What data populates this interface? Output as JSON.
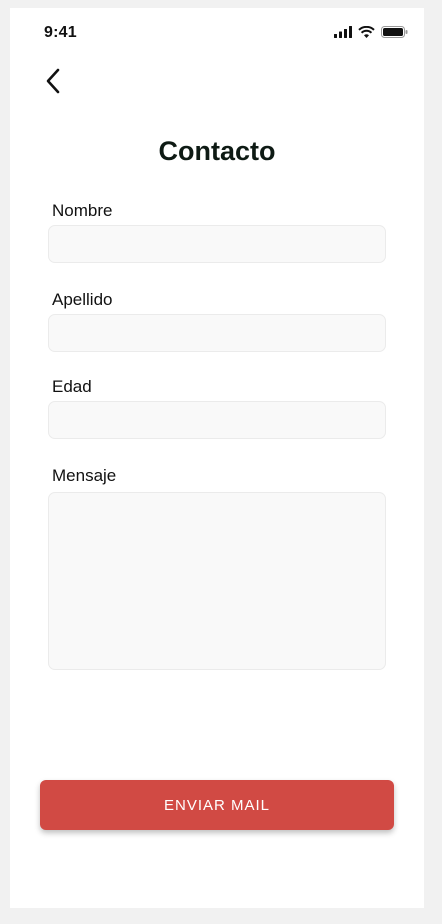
{
  "status_bar": {
    "time": "9:41",
    "icons": [
      "signal-icon",
      "wifi-icon",
      "battery-icon"
    ]
  },
  "header": {
    "back_icon": "chevron-left-icon",
    "title": "Contacto"
  },
  "form": {
    "nombre": {
      "label": "Nombre",
      "value": "",
      "placeholder": ""
    },
    "apellido": {
      "label": "Apellido",
      "value": "",
      "placeholder": ""
    },
    "edad": {
      "label": "Edad",
      "value": "",
      "placeholder": ""
    },
    "mensaje": {
      "label": "Mensaje",
      "value": "",
      "placeholder": ""
    }
  },
  "actions": {
    "send_label": "ENVIAR MAIL"
  },
  "colors": {
    "accent": "#d14a44",
    "title": "#0e1a14",
    "input_background": "#f9f9f9",
    "page_background": "#f1f1f1"
  }
}
